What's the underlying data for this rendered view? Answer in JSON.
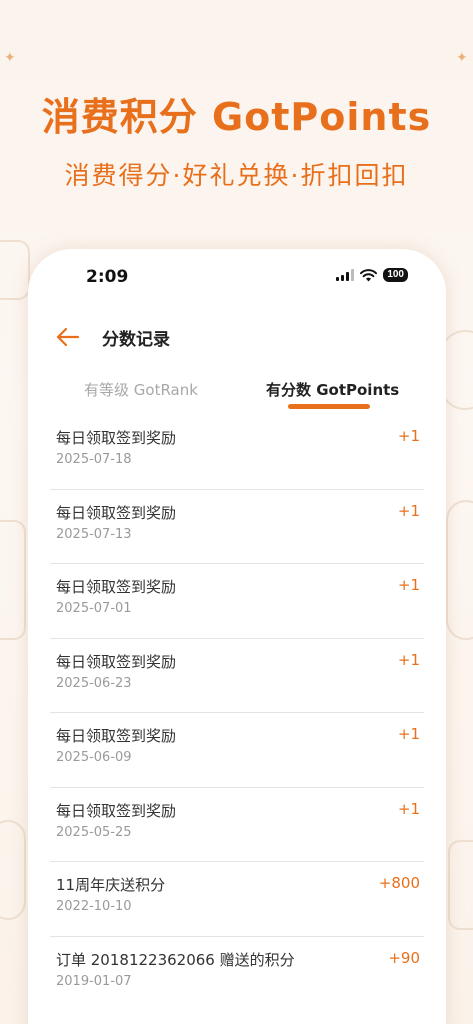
{
  "hero": {
    "title": "消费积分 GotPoints",
    "subtitle": "消费得分·好礼兑换·折扣回扣"
  },
  "status_bar": {
    "time": "2:09",
    "battery": "100"
  },
  "nav": {
    "title": "分数记录"
  },
  "tabs": [
    {
      "label": "有等级 GotRank",
      "active": false
    },
    {
      "label": "有分数 GotPoints",
      "active": true
    }
  ],
  "records": [
    {
      "title": "每日领取签到奖励",
      "date": "2025-07-18",
      "points": "+1"
    },
    {
      "title": "每日领取签到奖励",
      "date": "2025-07-13",
      "points": "+1"
    },
    {
      "title": "每日领取签到奖励",
      "date": "2025-07-01",
      "points": "+1"
    },
    {
      "title": "每日领取签到奖励",
      "date": "2025-06-23",
      "points": "+1"
    },
    {
      "title": "每日领取签到奖励",
      "date": "2025-06-09",
      "points": "+1"
    },
    {
      "title": "每日领取签到奖励",
      "date": "2025-05-25",
      "points": "+1"
    },
    {
      "title": "11周年庆送积分",
      "date": "2022-10-10",
      "points": "+800"
    },
    {
      "title": "订单 2018122362066 赠送的积分",
      "date": "2019-01-07",
      "points": "+90"
    }
  ],
  "colors": {
    "accent": "#e8701c",
    "background": "#fbf3ec"
  }
}
